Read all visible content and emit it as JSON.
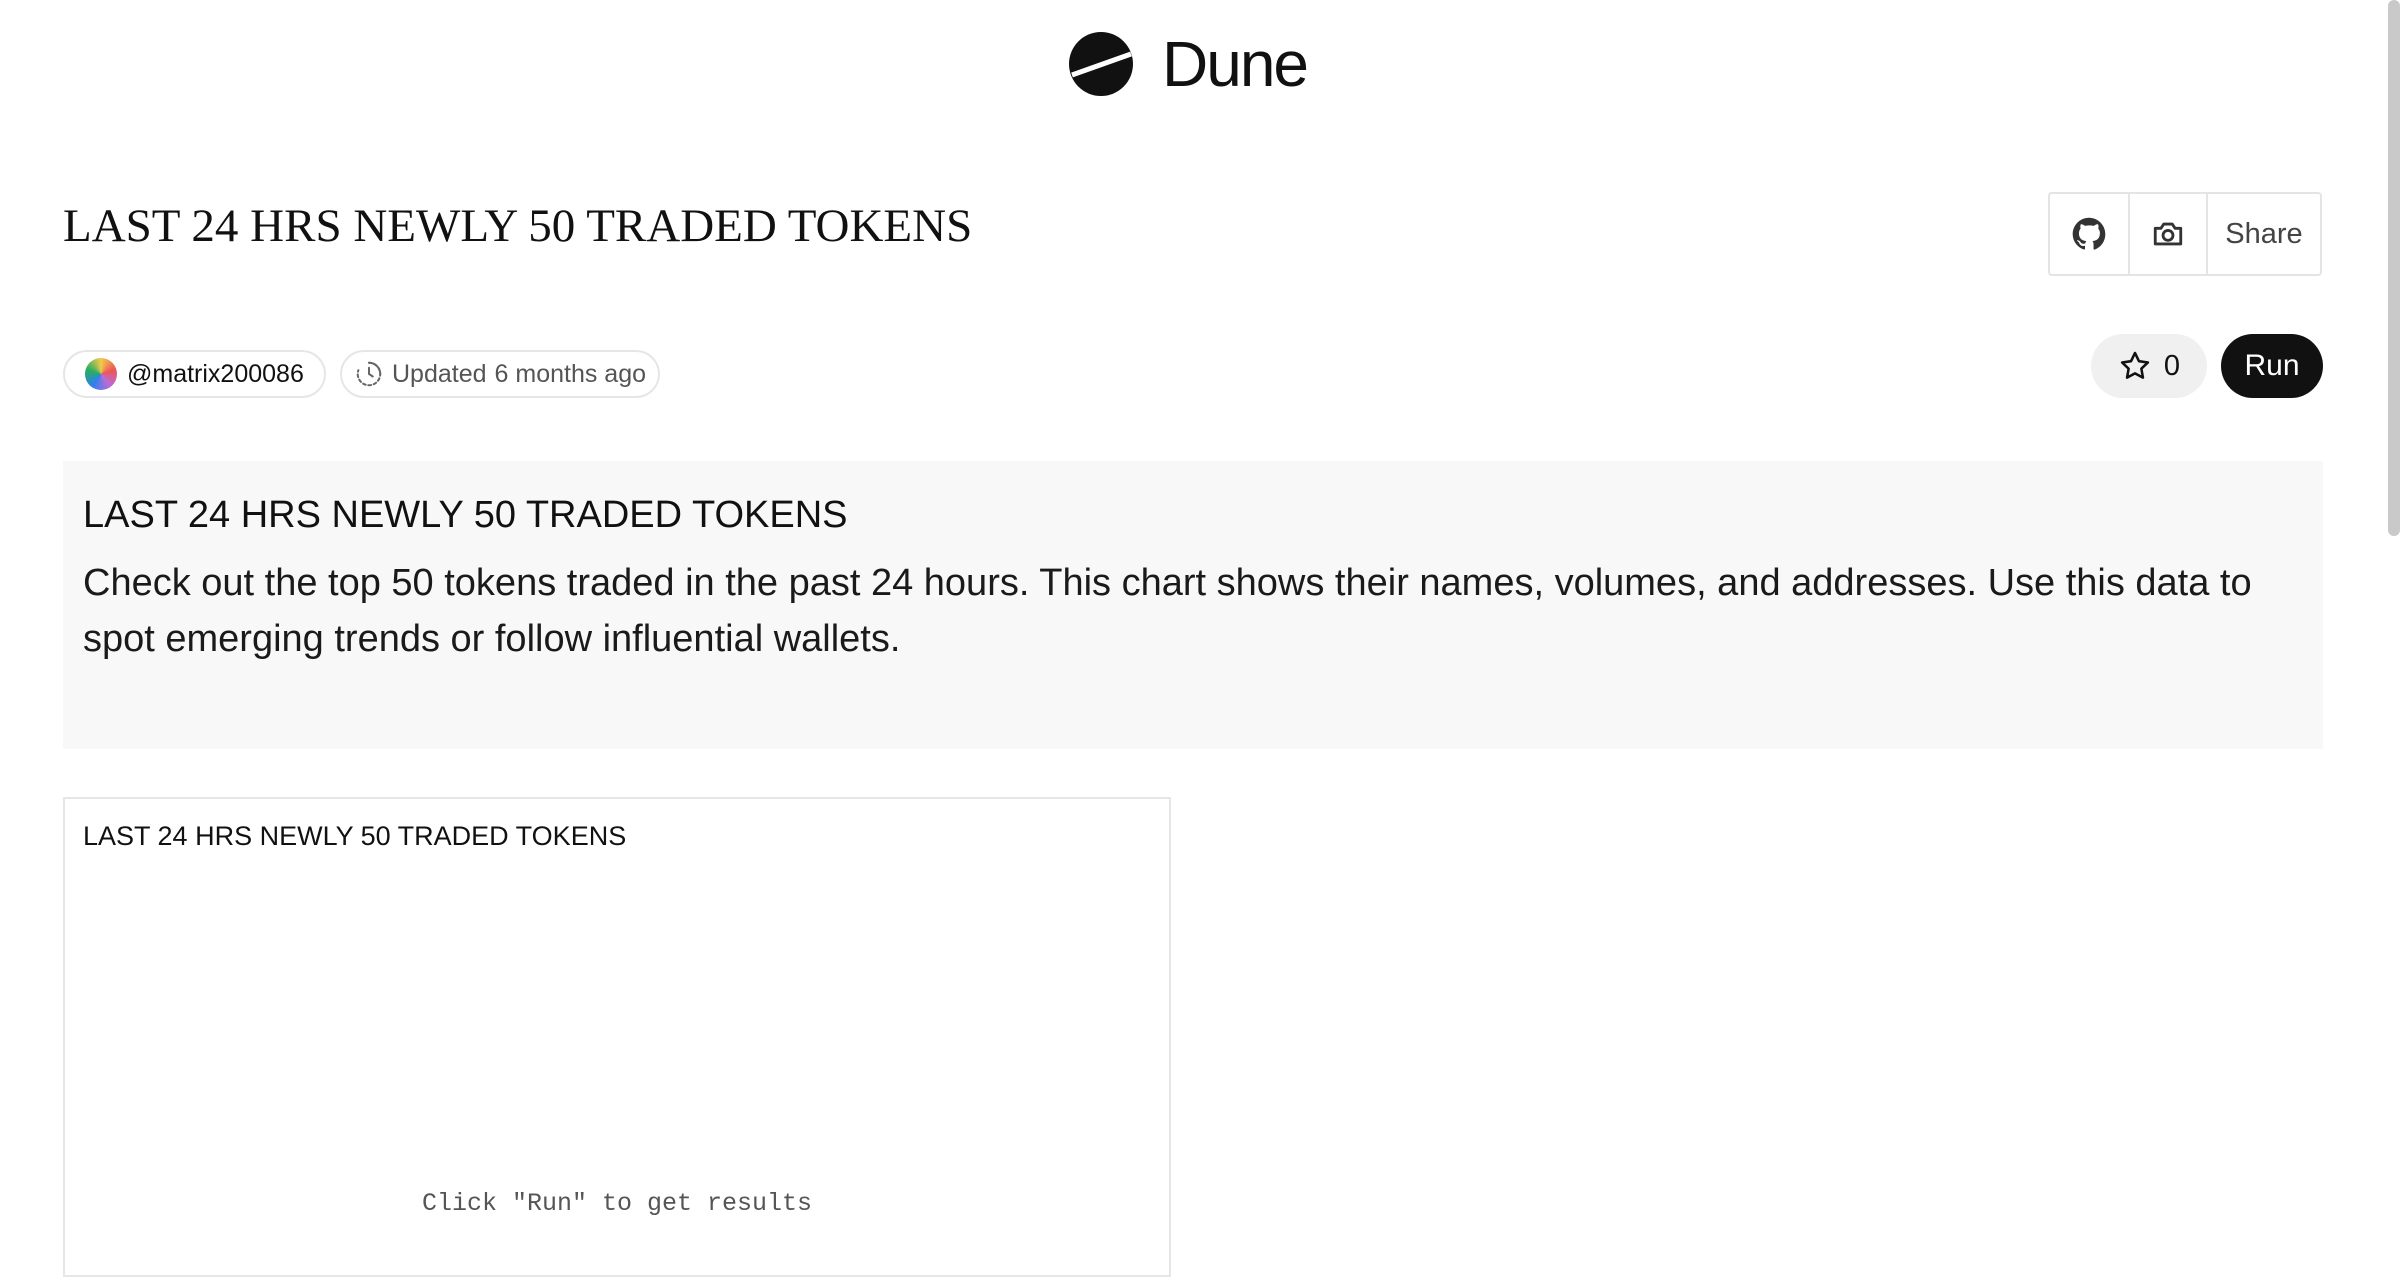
{
  "brand": {
    "name": "Dune"
  },
  "page": {
    "title": "LAST 24 HRS NEWLY 50 TRADED TOKENS"
  },
  "actions": {
    "github_icon": "github-icon",
    "camera_icon": "camera-icon",
    "share_label": "Share"
  },
  "meta": {
    "author": "@matrix200086",
    "updated_label": "Updated",
    "updated_time": "6 months ago"
  },
  "controls": {
    "star_count": "0",
    "run_label": "Run"
  },
  "description": {
    "heading": "LAST 24 HRS NEWLY 50 TRADED TOKENS",
    "body": "Check out the top 50 tokens traded in the past 24 hours. This chart shows their names, volumes, and addresses. Use this data to spot emerging trends or follow influential wallets."
  },
  "widget": {
    "title": "LAST 24 HRS NEWLY 50 TRADED TOKENS",
    "empty_message": "Click \"Run\" to get results"
  }
}
